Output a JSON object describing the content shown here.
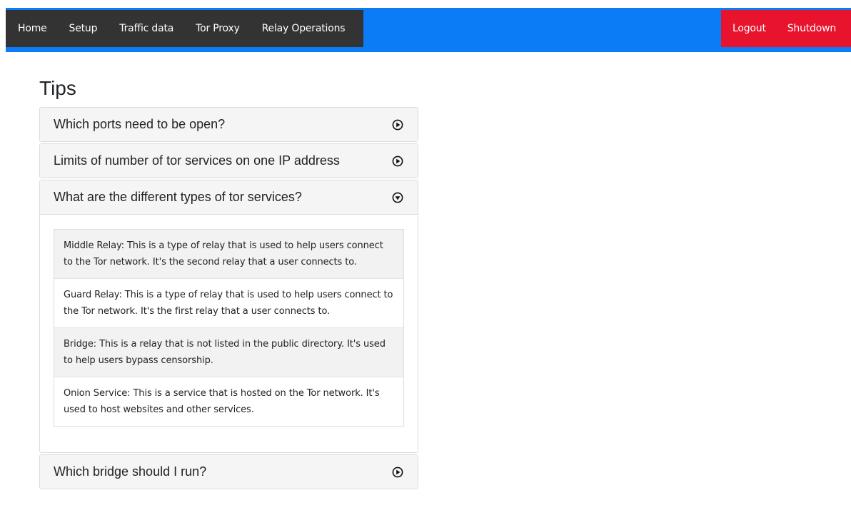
{
  "nav": {
    "left": [
      "Home",
      "Setup",
      "Traffic data",
      "Tor Proxy",
      "Relay Operations"
    ],
    "logout": "Logout",
    "shutdown": "Shutdown"
  },
  "page_title": "Tips",
  "accordion": [
    {
      "title": "Which ports need to be open?",
      "state": "collapsed"
    },
    {
      "title": "Limits of number of tor services on one IP address",
      "state": "collapsed"
    },
    {
      "title": "What are the different types of tor services?",
      "state": "expanded",
      "items": [
        "Middle Relay: This is a type of relay that is used to help users connect to the Tor network. It's the second relay that a user connects to.",
        "Guard Relay: This is a type of relay that is used to help users connect to the Tor network. It's the first relay that a user connects to.",
        "Bridge: This is a relay that is not listed in the public directory. It's used to help users bypass censorship.",
        "Onion Service: This is a service that is hosted on the Tor network. It's used to host websites and other services."
      ]
    },
    {
      "title": "Which bridge should I run?",
      "state": "collapsed"
    }
  ],
  "colors": {
    "topbar": "#0b7cf6",
    "nav_dark": "#333333",
    "nav_red": "#e8132d"
  },
  "icons": {
    "collapsed": "circle-play-icon",
    "expanded": "circle-chevron-down-icon"
  }
}
